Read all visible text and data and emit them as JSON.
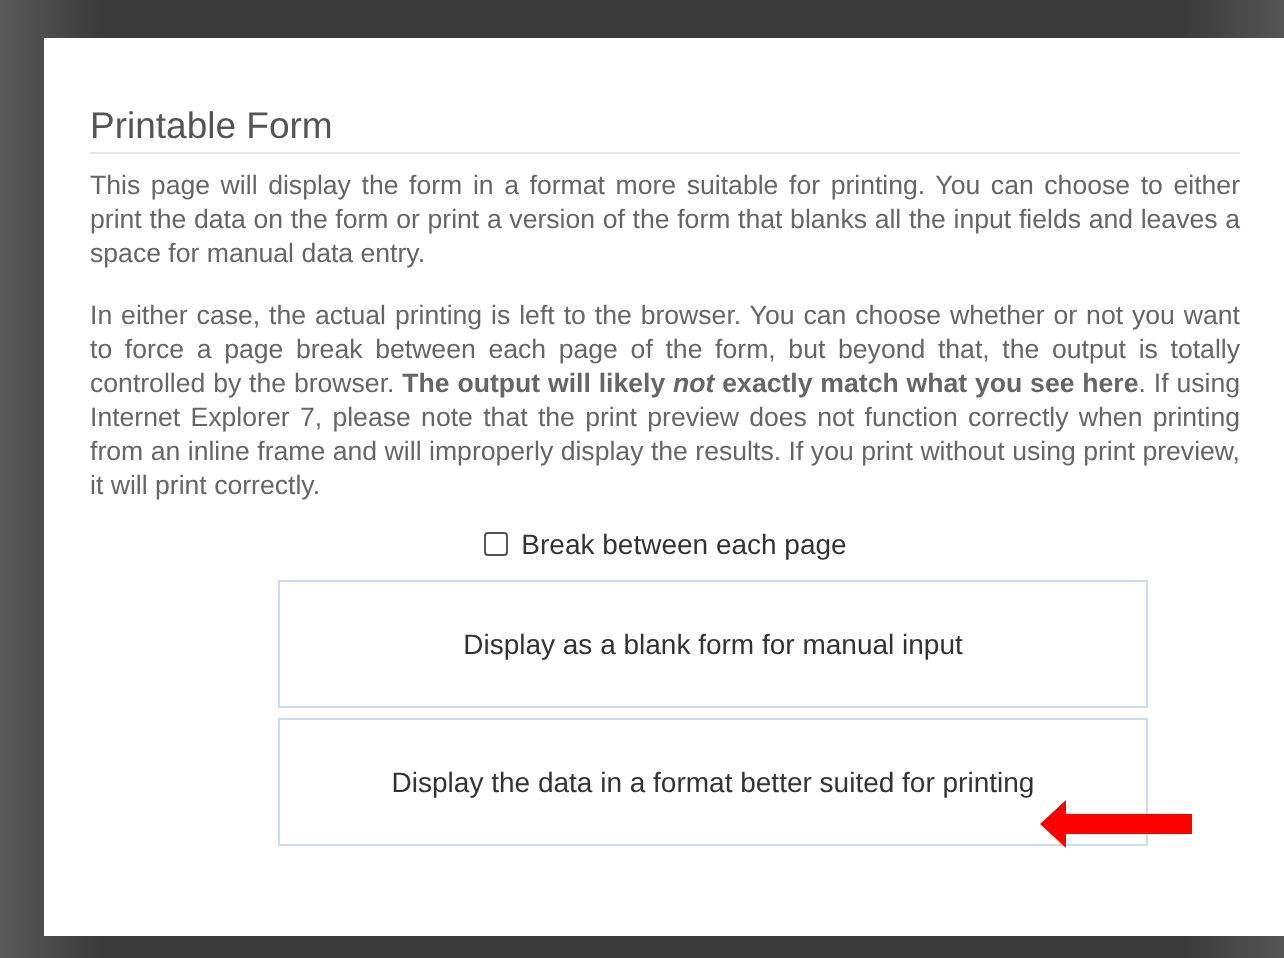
{
  "title": "Printable Form",
  "paragraphs": [
    "This page will display the form in a format more suitable for printing.  You can choose to either print the data on the form or print a version of the form that blanks all the input fields and leaves a space for manual data entry.",
    "In either case, the actual printing is left to the browser.  You can choose whether or not you want to force a page break between each page of the form, but beyond that, the output is totally controlled by the browser.  **The output will likely *not* exactly match what you see here**.  If using Internet Explorer 7, please note that the print preview does not function correctly when printing from an inline frame and will improperly display the results.  If you print without using print preview, it will print correctly."
  ],
  "checkbox": {
    "label": "Break between each page",
    "checked": false
  },
  "buttons": [
    {
      "label": "Display as a blank form for manual input",
      "pointed": false
    },
    {
      "label": "Display the data in a format better suited for printing",
      "pointed": true
    }
  ]
}
